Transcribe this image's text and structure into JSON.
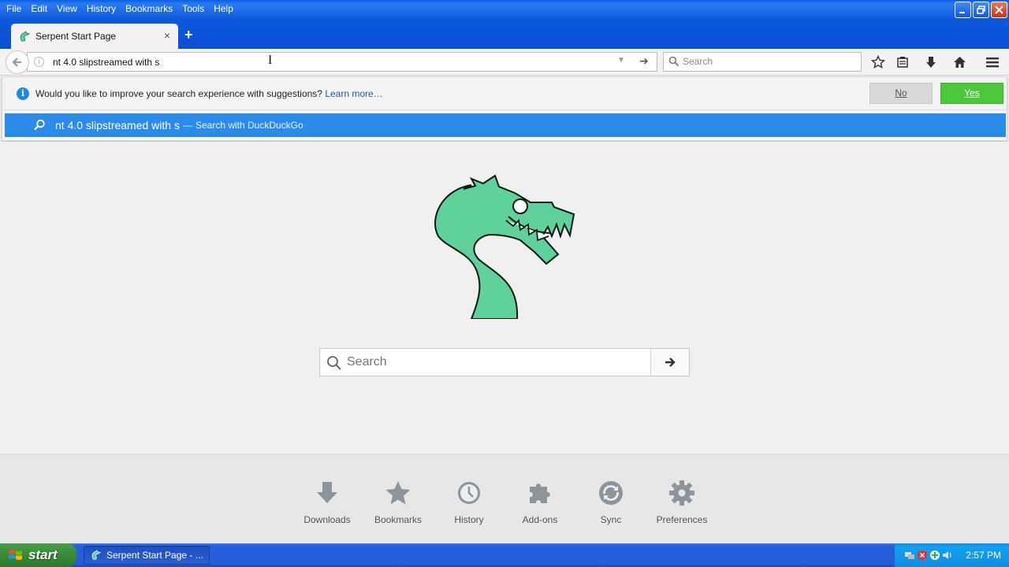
{
  "menu": [
    "File",
    "Edit",
    "View",
    "History",
    "Bookmarks",
    "Tools",
    "Help"
  ],
  "menu_accel": [
    "F",
    "E",
    "V",
    "H",
    "B",
    "T",
    "H"
  ],
  "tab": {
    "title": "Serpent Start Page",
    "close": "×"
  },
  "new_tab": "+",
  "urlbar": {
    "value": "nt 4.0 slipstreamed with s"
  },
  "searchbar": {
    "placeholder": "Search"
  },
  "notice": {
    "text": "Would you like to improve your search experience with suggestions?",
    "link": "Learn more…",
    "no": "No",
    "yes": "Yes"
  },
  "suggestion": {
    "query": "nt 4.0 slipstreamed with s",
    "separator": "—",
    "action": "Search with DuckDuckGo"
  },
  "page_search": {
    "placeholder": "Search"
  },
  "launcher": [
    "Downloads",
    "Bookmarks",
    "History",
    "Add-ons",
    "Sync",
    "Preferences"
  ],
  "taskbar": {
    "start": "start",
    "window": "Serpent Start Page - ...",
    "clock": "2:57 PM"
  },
  "colors": {
    "accent": "#2a8be8",
    "yes_green": "#4cc63a",
    "logo_green": "#5fd19a"
  }
}
